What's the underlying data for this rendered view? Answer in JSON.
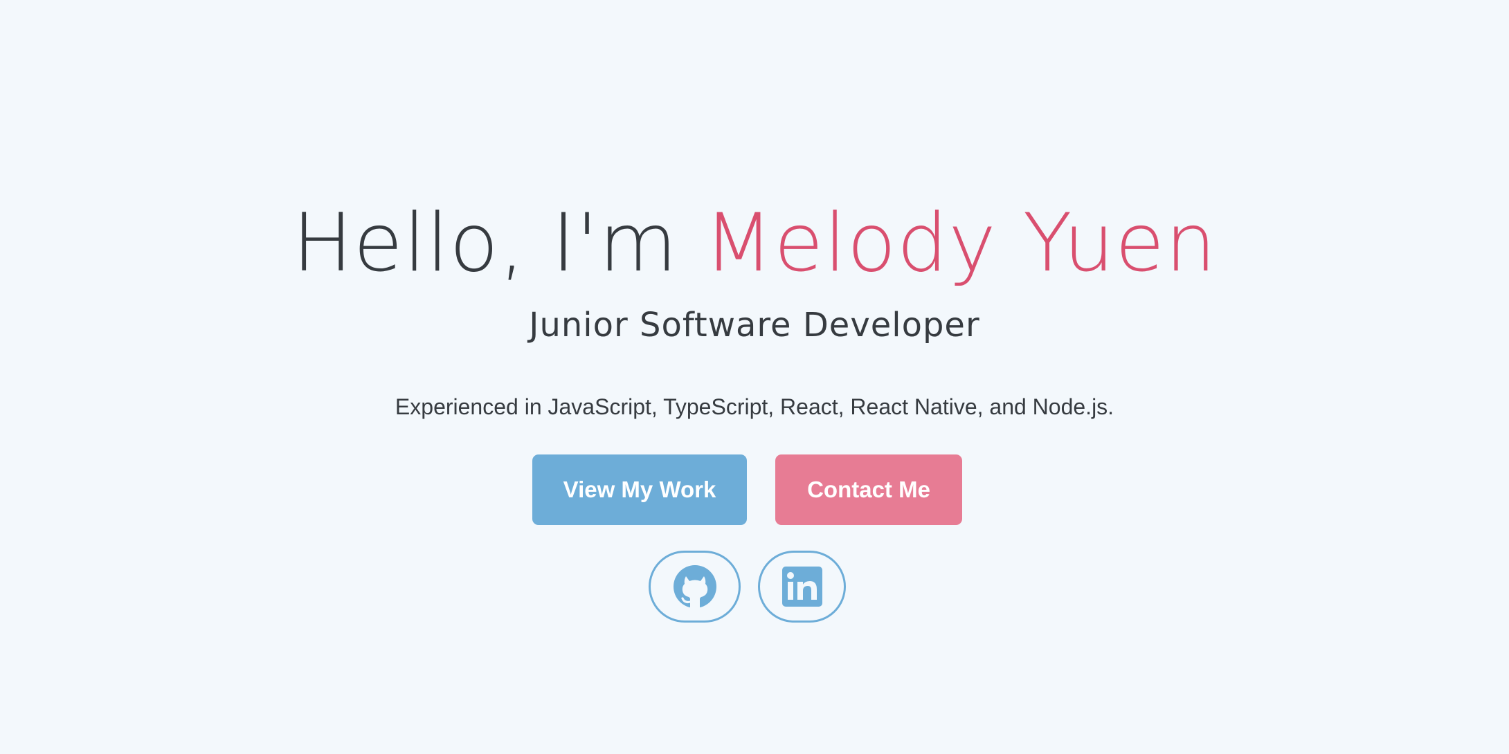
{
  "hero": {
    "greeting": "Hello, I'm ",
    "name": "Melody Yuen",
    "role": "Junior Software Developer",
    "tagline": "Experienced in JavaScript, TypeScript, React, React Native, and Node.js."
  },
  "buttons": {
    "view_work_label": "View My Work",
    "contact_label": "Contact Me"
  },
  "social": [
    {
      "icon": "github-icon",
      "label": "GitHub"
    },
    {
      "icon": "linkedin-icon",
      "label": "LinkedIn"
    }
  ],
  "colors": {
    "background": "#f3f8fc",
    "text": "#363b40",
    "accent_pink": "#d94f6f",
    "button_blue": "#6dadd8",
    "button_pink": "#e77c94"
  }
}
